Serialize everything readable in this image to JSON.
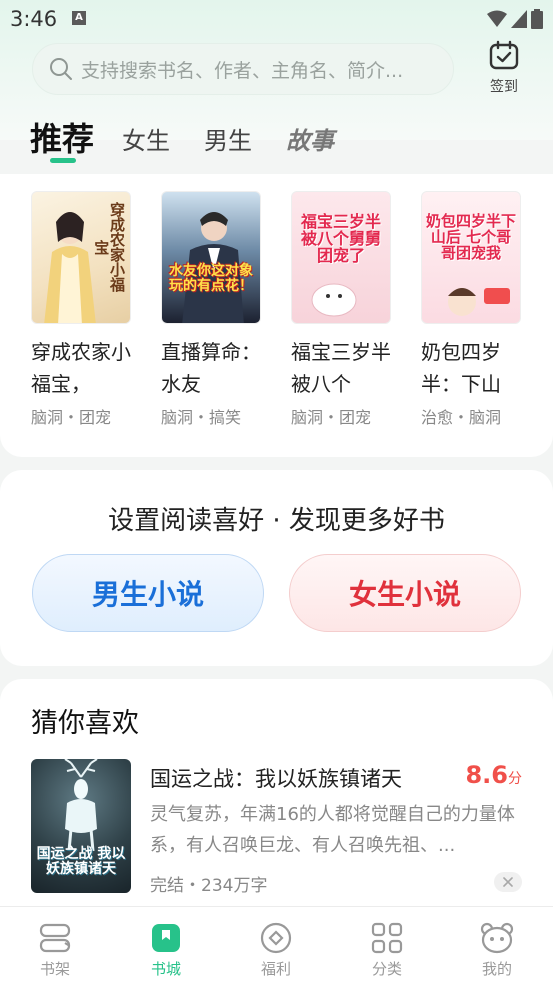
{
  "status_bar": {
    "time": "3:46",
    "notification_letter": "A"
  },
  "search": {
    "placeholder": "支持搜索书名、作者、主角名、简介..."
  },
  "checkin": {
    "label": "签到"
  },
  "tabs": [
    {
      "label": "推荐"
    },
    {
      "label": "女生"
    },
    {
      "label": "男生"
    },
    {
      "label": "故事"
    }
  ],
  "recommended_books": [
    {
      "title": "穿成农家小福宝，",
      "tags": "脑洞・团宠",
      "cover_text": "穿成农家小福宝"
    },
    {
      "title": "直播算命：水友",
      "tags": "脑洞・搞笑",
      "cover_text": "水友你这对象玩的有点花！"
    },
    {
      "title": "福宝三岁半被八个",
      "tags": "脑洞・团宠",
      "cover_text": "福宝三岁半 被八个舅舅团宠了"
    },
    {
      "title": "奶包四岁半：下山",
      "tags": "治愈・脑洞",
      "cover_text": "奶包四岁半下山后 七个哥哥团宠我"
    }
  ],
  "preference": {
    "title": "设置阅读喜好 · 发现更多好书",
    "male_label": "男生小说",
    "female_label": "女生小说"
  },
  "guess": {
    "section_title": "猜你喜欢",
    "book": {
      "title": "国运之战：我以妖族镇诸天",
      "score": "8.6",
      "score_unit": "分",
      "description": "灵气复苏，年满16的人都将觉醒自己的力量体系，有人召唤巨龙、有人召唤先祖、...",
      "meta": "完结・234万字",
      "cover_text": "国运之战 我以妖族镇诸天"
    }
  },
  "bottom_nav": [
    {
      "label": "书架",
      "icon": "bookshelf-icon"
    },
    {
      "label": "书城",
      "icon": "bookstore-icon"
    },
    {
      "label": "福利",
      "icon": "welfare-icon"
    },
    {
      "label": "分类",
      "icon": "category-icon"
    },
    {
      "label": "我的",
      "icon": "profile-icon"
    }
  ],
  "colors": {
    "accent": "#27c28a",
    "male": "#1a6fd8",
    "female": "#e0313c",
    "score": "#f0504a"
  }
}
